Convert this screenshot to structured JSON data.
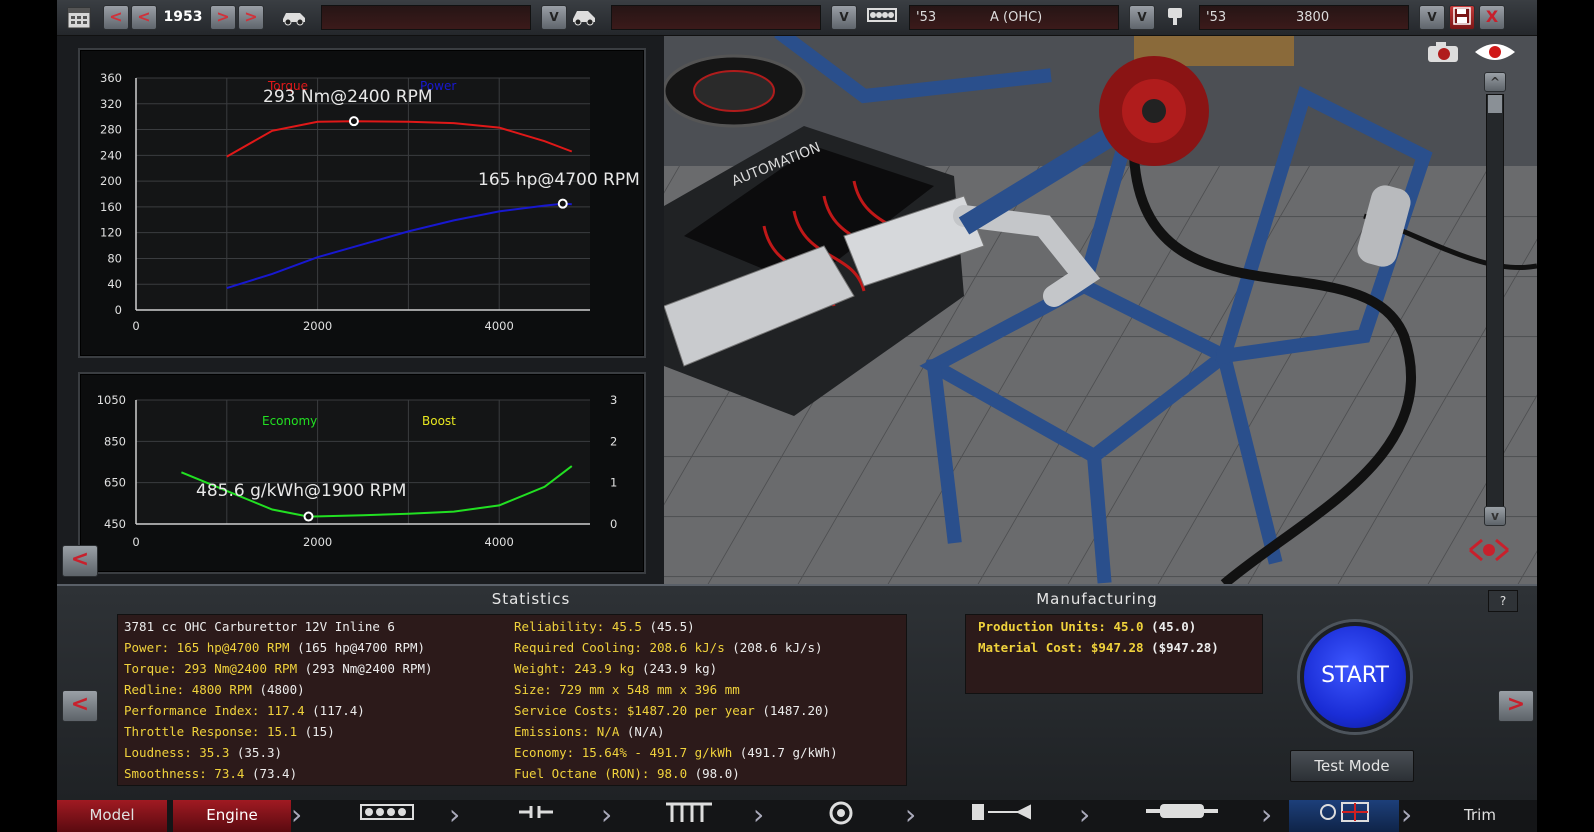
{
  "topbar": {
    "prev_label": "<",
    "next_label": ">",
    "year": "1953",
    "family_year": "'53",
    "family_name": "A (OHC)",
    "variant_year": "'53",
    "variant_name": "3800",
    "dropdown_label": "V",
    "close_label": "X"
  },
  "torque_chart": {
    "series_torque_label": "Torque",
    "series_power_label": "Power",
    "torque_peak_label": "293 Nm@2400 RPM",
    "power_peak_label": "165 hp@4700 RPM",
    "yticks": [
      "360",
      "320",
      "280",
      "240",
      "200",
      "160",
      "120",
      "80",
      "40",
      "0"
    ],
    "xticks": [
      "0",
      "2000",
      "4000"
    ],
    "colors": {
      "torque": "#e01818",
      "power": "#1818d0"
    }
  },
  "economy_chart": {
    "economy_label": "Economy",
    "boost_label": "Boost",
    "economy_peak_label": "485.6 g/kWh@1900 RPM",
    "yticks_left": [
      "1050",
      "850",
      "650",
      "450"
    ],
    "yticks_right": [
      "3",
      "2",
      "1",
      "0"
    ],
    "xticks": [
      "0",
      "2000",
      "4000"
    ],
    "colors": {
      "economy": "#22e022",
      "boost": "#e8e820"
    }
  },
  "chart_data": [
    {
      "type": "line",
      "title": "",
      "xlabel": "",
      "ylabel": "",
      "xlim": [
        0,
        5000
      ],
      "ylim": [
        0,
        360
      ],
      "series": [
        {
          "name": "Torque",
          "x": [
            1000,
            1500,
            2000,
            2400,
            3000,
            3500,
            4000,
            4500,
            4800
          ],
          "values": [
            238,
            278,
            292,
            293,
            292,
            290,
            283,
            262,
            246
          ]
        },
        {
          "name": "Power",
          "x": [
            1000,
            1500,
            2000,
            2500,
            3000,
            3500,
            4000,
            4500,
            4700,
            4800
          ],
          "values": [
            34,
            56,
            82,
            102,
            122,
            139,
            153,
            162,
            165,
            164
          ]
        }
      ]
    },
    {
      "type": "line",
      "title": "",
      "xlabel": "",
      "ylabel": "",
      "xlim": [
        0,
        5000
      ],
      "ylim": [
        450,
        1050
      ],
      "series": [
        {
          "name": "Economy",
          "x": [
            500,
            1000,
            1500,
            1900,
            2500,
            3000,
            3500,
            4000,
            4500,
            4800
          ],
          "values": [
            700,
            610,
            520,
            486,
            492,
            500,
            510,
            540,
            630,
            730
          ]
        }
      ]
    }
  ],
  "statistics": {
    "header": "Statistics",
    "description": "3781 cc OHC Carburettor 12V Inline 6",
    "left": [
      {
        "k": "Power: 165 hp@4700 RPM",
        "v": "(165 hp@4700 RPM)"
      },
      {
        "k": "Torque: 293 Nm@2400 RPM",
        "v": "(293 Nm@2400 RPM)"
      },
      {
        "k": "Redline: 4800 RPM",
        "v": "(4800)"
      },
      {
        "k": "Performance Index: 117.4",
        "v": "(117.4)"
      },
      {
        "k": "Throttle Response: 15.1",
        "v": "(15)"
      },
      {
        "k": "Loudness: 35.3",
        "v": "(35.3)"
      },
      {
        "k": "Smoothness: 73.4",
        "v": "(73.4)"
      }
    ],
    "right": [
      {
        "k": "Reliability: 45.5",
        "v": "(45.5)"
      },
      {
        "k": "Required Cooling: 208.6 kJ/s",
        "v": "(208.6 kJ/s)"
      },
      {
        "k": "Weight: 243.9 kg",
        "v": "(243.9 kg)"
      },
      {
        "k": "Size: 729 mm x 548 mm x 396 mm",
        "v": ""
      },
      {
        "k": "Service Costs: $1487.20 per year",
        "v": "(1487.20)"
      },
      {
        "k": "Emissions: N/A",
        "v": "(N/A)"
      },
      {
        "k": "Economy: 15.64% - 491.7 g/kWh",
        "v": "(491.7 g/kWh)"
      },
      {
        "k": "Fuel Octane (RON): 98.0",
        "v": "(98.0)"
      }
    ]
  },
  "manufacturing": {
    "header": "Manufacturing",
    "lines": [
      {
        "k": "Production Units: 45.0",
        "v": "(45.0)"
      },
      {
        "k": "Material Cost: $947.28",
        "v": "($947.28)"
      }
    ]
  },
  "actions": {
    "start_label": "START",
    "test_mode_label": "Test Mode",
    "help_label": "?",
    "back_label": "<",
    "forward_label": ">"
  },
  "tabs": {
    "model": "Model",
    "engine": "Engine",
    "trim": "Trim"
  }
}
